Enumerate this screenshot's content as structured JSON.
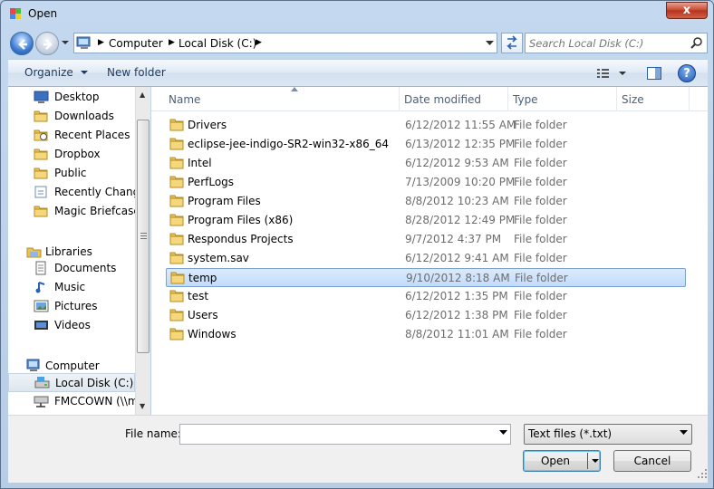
{
  "window": {
    "title": "Open",
    "close_glyph": "x"
  },
  "address": {
    "crumbs": [
      "Computer",
      "Local Disk (C:)"
    ],
    "search_placeholder": "Search Local Disk (C:)"
  },
  "toolbar": {
    "organize_label": "Organize",
    "new_folder_label": "New folder"
  },
  "nav": {
    "favorites": [
      {
        "label": "Desktop",
        "icon": "desktop-icon"
      },
      {
        "label": "Downloads",
        "icon": "folder-icon"
      },
      {
        "label": "Recent Places",
        "icon": "recent-places-icon"
      },
      {
        "label": "Dropbox",
        "icon": "folder-icon"
      },
      {
        "label": "Public",
        "icon": "folder-icon"
      },
      {
        "label": "Recently Changed",
        "icon": "recent-changed-icon"
      },
      {
        "label": "Magic Briefcase",
        "icon": "folder-icon"
      }
    ],
    "libraries_label": "Libraries",
    "libraries": [
      {
        "label": "Documents",
        "icon": "documents-icon"
      },
      {
        "label": "Music",
        "icon": "music-icon"
      },
      {
        "label": "Pictures",
        "icon": "pictures-icon"
      },
      {
        "label": "Videos",
        "icon": "videos-icon"
      }
    ],
    "computer_label": "Computer",
    "drives": [
      {
        "label": "Local Disk (C:)",
        "icon": "local-disk-icon"
      },
      {
        "label": "FMCCOWN (\\\\m",
        "icon": "network-drive-icon"
      }
    ]
  },
  "columns": {
    "name": "Name",
    "date": "Date modified",
    "type": "Type",
    "size": "Size"
  },
  "files": [
    {
      "name": "Drivers",
      "date": "6/12/2012 11:55 AM",
      "type": "File folder"
    },
    {
      "name": "eclipse-jee-indigo-SR2-win32-x86_64",
      "date": "6/13/2012 12:35 PM",
      "type": "File folder"
    },
    {
      "name": "Intel",
      "date": "6/12/2012 9:53 AM",
      "type": "File folder"
    },
    {
      "name": "PerfLogs",
      "date": "7/13/2009 10:20 PM",
      "type": "File folder"
    },
    {
      "name": "Program Files",
      "date": "8/8/2012 10:23 AM",
      "type": "File folder"
    },
    {
      "name": "Program Files (x86)",
      "date": "8/28/2012 12:49 PM",
      "type": "File folder"
    },
    {
      "name": "Respondus Projects",
      "date": "9/7/2012 4:37 PM",
      "type": "File folder"
    },
    {
      "name": "system.sav",
      "date": "6/12/2012 9:41 AM",
      "type": "File folder"
    },
    {
      "name": "temp",
      "date": "9/10/2012 8:18 AM",
      "type": "File folder"
    },
    {
      "name": "test",
      "date": "6/12/2012 1:35 PM",
      "type": "File folder"
    },
    {
      "name": "Users",
      "date": "6/12/2012 1:38 PM",
      "type": "File folder"
    },
    {
      "name": "Windows",
      "date": "8/8/2012 11:01 AM",
      "type": "File folder"
    }
  ],
  "selected_file_index": 8,
  "bottom": {
    "filename_label": "File name:",
    "filename_value": "",
    "filetype_value": "Text files (*.txt)",
    "open_label": "Open",
    "cancel_label": "Cancel"
  },
  "colors": {
    "accent": "#3c7fb1",
    "selection": "#c1dbfc",
    "folder": "#e8c25a"
  }
}
